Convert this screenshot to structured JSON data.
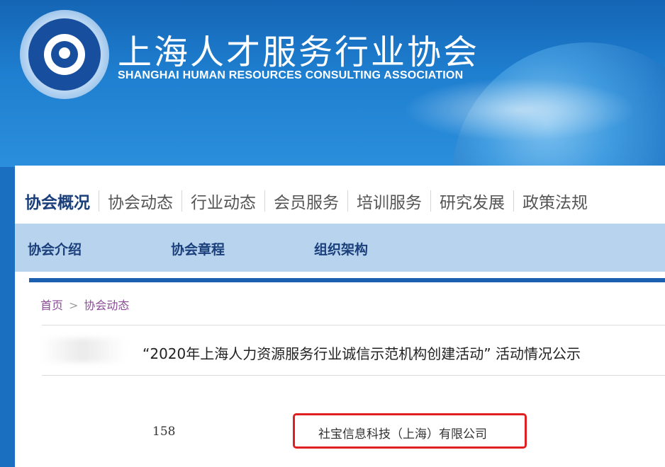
{
  "header": {
    "title": "上海人才服务行业协会",
    "subtitle": "SHANGHAI HUMAN RESOURCES CONSULTING ASSOCIATION"
  },
  "nav": {
    "items": [
      "协会概况",
      "协会动态",
      "行业动态",
      "会员服务",
      "培训服务",
      "研究发展",
      "政策法规"
    ],
    "active": "协会概况"
  },
  "subnav": {
    "items": [
      "协会介绍",
      "协会章程",
      "组织架构"
    ]
  },
  "breadcrumb": {
    "home": "首页",
    "separator": ">",
    "current": "协会动态"
  },
  "article": {
    "title": "“2020年上海人力资源服务行业诚信示范机构创建活动”  活动情况公示"
  },
  "row": {
    "number": "158",
    "company": "社宝信息科技（上海）有限公司"
  },
  "colors": {
    "highlight_border": "#e02020",
    "nav_active": "#1b3f7a",
    "subnav_bg": "#b7d3ee"
  }
}
